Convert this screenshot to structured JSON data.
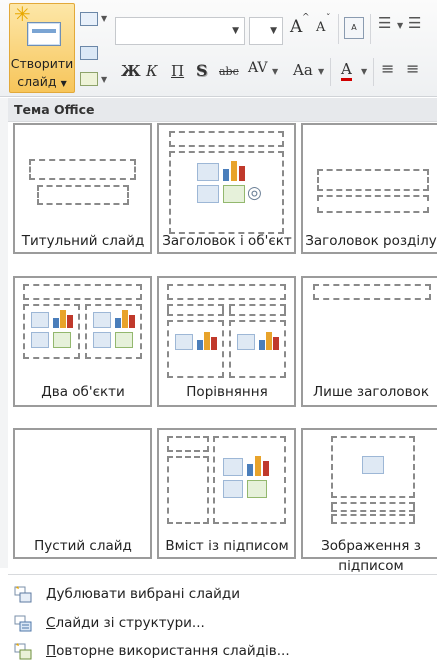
{
  "ribbon": {
    "new_slide_line1": "Створити",
    "new_slide_line2": "слайд",
    "font_name": "",
    "font_size": "",
    "grow_font": "A",
    "shrink_font": "A",
    "bold": "Ж",
    "italic": "К",
    "underline": "П",
    "shadow": "S",
    "strike": "abc",
    "spacing": "AV",
    "change_case": "Aa",
    "font_color": "A"
  },
  "gallery": {
    "section_title": "Тема Office",
    "layouts": [
      {
        "label": "Титульний слайд"
      },
      {
        "label": "Заголовок і об'єкт"
      },
      {
        "label": "Заголовок розділу"
      },
      {
        "label": "Два об'єкти"
      },
      {
        "label": "Порівняння"
      },
      {
        "label": "Лише заголовок"
      },
      {
        "label": "Пустий слайд"
      },
      {
        "label": "Вміст із підписом"
      },
      {
        "label": "Зображення з підписом"
      }
    ]
  },
  "menu": {
    "duplicate": {
      "pre": "",
      "key": "Д",
      "post": "ублювати вибрані слайди"
    },
    "outline": {
      "pre": "",
      "key": "С",
      "post": "лайди зі структури..."
    },
    "reuse": {
      "pre": "",
      "key": "П",
      "post": "овторне використання слайдів..."
    }
  },
  "colors": {
    "accent_button": "#f7c55a",
    "tile_border": "#9b9b9b",
    "placeholder_dash": "#8a8a8a"
  }
}
